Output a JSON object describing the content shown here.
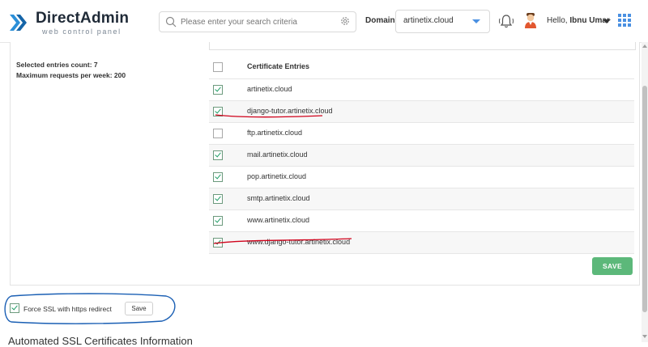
{
  "header": {
    "logo_title": "DirectAdmin",
    "logo_subtitle": "web control panel",
    "search_placeholder": "Please enter your search criteria",
    "domain_label": "Domain",
    "domain_value": "artinetix.cloud",
    "greeting": "Hello,",
    "user_name": "Ibnu Umar"
  },
  "stats": {
    "selected_count": "Selected entries count: 7",
    "max_requests": "Maximum requests per week: 200"
  },
  "table": {
    "header": "Certificate Entries",
    "rows": [
      {
        "name": "artinetix.cloud",
        "checked": true
      },
      {
        "name": "django-tutor.artinetix.cloud",
        "checked": true
      },
      {
        "name": "ftp.artinetix.cloud",
        "checked": false
      },
      {
        "name": "mail.artinetix.cloud",
        "checked": true
      },
      {
        "name": "pop.artinetix.cloud",
        "checked": true
      },
      {
        "name": "smtp.artinetix.cloud",
        "checked": true
      },
      {
        "name": "www.artinetix.cloud",
        "checked": true
      },
      {
        "name": "www.django-tutor.artinetix.cloud",
        "checked": true
      }
    ]
  },
  "actions": {
    "save_label": "SAVE"
  },
  "force_ssl": {
    "label": "Force SSL with https redirect",
    "checked": true,
    "save_label": "Save"
  },
  "section": {
    "title": "Automated SSL Certificates Information"
  },
  "colors": {
    "accent": "#4a90e2",
    "save_green": "#5cb87a",
    "check_green": "#1e9e66",
    "annotation_red": "#d0021b",
    "annotation_blue": "#1a5fb4"
  }
}
